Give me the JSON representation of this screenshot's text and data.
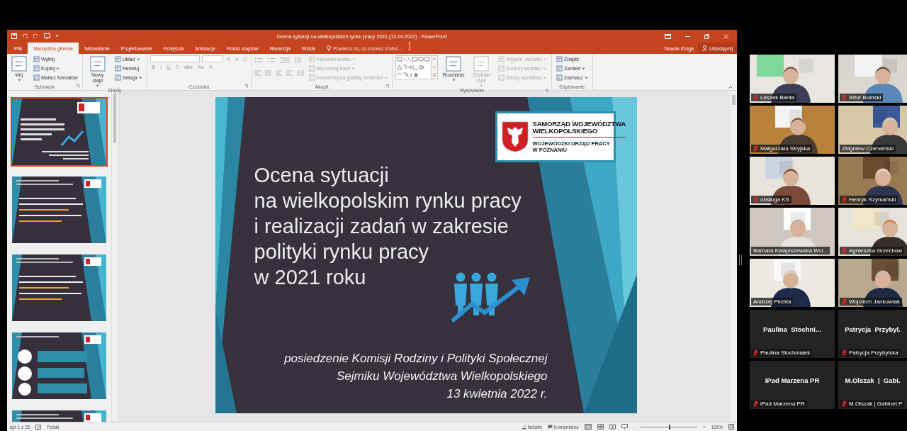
{
  "powerpoint": {
    "window": {
      "title": "Ocena sytuacji na wielkopolskim rynku pracy 2021 (13.04.2022) - PowerPoint"
    },
    "tabs": [
      {
        "label": "Plik",
        "selected": false
      },
      {
        "label": "Narzędzia główne",
        "selected": true
      },
      {
        "label": "Wstawianie",
        "selected": false
      },
      {
        "label": "Projektowanie",
        "selected": false
      },
      {
        "label": "Przejścia",
        "selected": false
      },
      {
        "label": "Animacje",
        "selected": false
      },
      {
        "label": "Pokaz slajdów",
        "selected": false
      },
      {
        "label": "Recenzja",
        "selected": false
      },
      {
        "label": "Widok",
        "selected": false
      }
    ],
    "tell_me": "Powiedz mi, co chcesz zrobić...",
    "user": "Nowak Kinga",
    "share_button": "Udostępnij",
    "ribbon": [
      {
        "label": "Schowek",
        "launcher": true,
        "columns": [
          [
            {
              "kind": "large",
              "label": "klej",
              "dropdown": true,
              "disabled": false
            }
          ],
          [
            {
              "kind": "small",
              "label": "Wytnij",
              "dropdown": false,
              "disabled": false
            },
            {
              "kind": "small",
              "label": "Kopiuj",
              "dropdown": true,
              "disabled": false
            },
            {
              "kind": "small",
              "label": "Malarz formatów",
              "dropdown": false,
              "disabled": false
            }
          ]
        ]
      },
      {
        "label": "Slajdy",
        "launcher": false,
        "columns": [
          [
            {
              "kind": "large",
              "label": "Nowy slajd",
              "dropdown": true,
              "disabled": false
            }
          ],
          [
            {
              "kind": "small",
              "label": "Układ",
              "dropdown": true,
              "disabled": false
            },
            {
              "kind": "small",
              "label": "Resetuj",
              "dropdown": false,
              "disabled": false
            },
            {
              "kind": "small",
              "label": "Sekcja",
              "dropdown": true,
              "disabled": false
            }
          ]
        ]
      },
      {
        "label": "Czcionka",
        "launcher": true,
        "columns": [
          [
            {
              "kind": "fields",
              "buttons": [
                "A",
                "A"
              ],
              "disabled": true
            },
            {
              "kind": "format",
              "buttons": [
                "B",
                "I",
                "U",
                "S",
                "abc",
                "Aa",
                "A"
              ],
              "disabled": true
            }
          ]
        ]
      },
      {
        "label": "Akapit",
        "launcher": true,
        "columns": [
          [
            {
              "kind": "paragraph_icons",
              "disabled": true
            }
          ],
          [
            {
              "kind": "small",
              "label": "Kierunek tekstu",
              "dropdown": true,
              "disabled": true
            },
            {
              "kind": "small",
              "label": "Wyrównaj tekst",
              "dropdown": true,
              "disabled": true
            },
            {
              "kind": "small",
              "label": "Konwertuj na grafikę SmartArt",
              "dropdown": true,
              "disabled": true
            }
          ]
        ]
      },
      {
        "label": "Rysowanie",
        "launcher": true,
        "columns": [
          [
            {
              "kind": "shapes",
              "disabled": false
            }
          ],
          [
            {
              "kind": "large",
              "label": "Rozmieść",
              "dropdown": true,
              "disabled": false
            }
          ],
          [
            {
              "kind": "large",
              "label": "Szybkie style",
              "dropdown": true,
              "disabled": true
            }
          ],
          [
            {
              "kind": "small",
              "label": "Wypełn. kształtu",
              "dropdown": true,
              "disabled": true
            },
            {
              "kind": "small",
              "label": "Kontury kształtu",
              "dropdown": true,
              "disabled": true
            },
            {
              "kind": "small",
              "label": "Efekty kształtów",
              "dropdown": true,
              "disabled": true
            }
          ]
        ]
      },
      {
        "label": "Edytowanie",
        "launcher": false,
        "columns": [
          [
            {
              "kind": "small",
              "label": "Znajdź",
              "dropdown": false,
              "disabled": false
            },
            {
              "kind": "small",
              "label": "Zamień",
              "dropdown": true,
              "disabled": false
            },
            {
              "kind": "small",
              "label": "Zaznacz",
              "dropdown": true,
              "disabled": false
            }
          ]
        ]
      }
    ],
    "thumbnails": [
      {
        "kind": "title",
        "selected": true
      },
      {
        "kind": "text",
        "selected": false
      },
      {
        "kind": "text",
        "selected": false
      },
      {
        "kind": "icons",
        "selected": false
      },
      {
        "kind": "text",
        "selected": false
      }
    ],
    "slide": {
      "logo": {
        "heading": [
          "SAMORZĄD WOJEWÓDZTWA",
          "WIELKOPOLSKIEGO"
        ],
        "subheading": [
          "WOJEWÓDZKI URZĄD PRACY",
          "W POZNANIU"
        ]
      },
      "title_lines": [
        "Ocena sytuacji",
        "na wielkopolskim rynku pracy",
        "i realizacji zadań w zakresie",
        "polityki rynku pracy",
        "w 2021 roku"
      ],
      "subtitle_lines": [
        "posiedzenie Komisji Rodziny i Polityki Społecznej",
        "Sejmiku Województwa Wielkopolskiego",
        "13 kwietnia 2022 r."
      ]
    },
    "status_bar": {
      "slide_counter": "ajd 1 z 25",
      "language": "Polski",
      "notes": "Notatki",
      "comments": "Komentarze",
      "zoom_out": "-",
      "zoom_in": "+",
      "zoom_slider": {
        "level": 0.5
      },
      "zoom": "115%"
    }
  },
  "participants": [
    {
      "kind": "video",
      "name": "Leszek Bierła",
      "muted": true,
      "speaking": false
    },
    {
      "kind": "video",
      "name": "Artur Boiński",
      "muted": true,
      "speaking": false
    },
    {
      "kind": "video",
      "name": "Małgorzata Stryjska",
      "muted": true,
      "speaking": false
    },
    {
      "kind": "video",
      "name": "Zbigniew Czerwiński",
      "muted": false,
      "speaking": false
    },
    {
      "kind": "video",
      "name": "obsługa KS",
      "muted": true,
      "speaking": false
    },
    {
      "kind": "video",
      "name": "Henryk Szymański",
      "muted": true,
      "speaking": false
    },
    {
      "kind": "video",
      "name": "Barbara Kwapiszewska WU...",
      "muted": false,
      "speaking": true
    },
    {
      "kind": "video",
      "name": "Agnieszka Grzechow",
      "muted": true,
      "speaking": false
    },
    {
      "kind": "video",
      "name": "Andrzej Plichta",
      "muted": false,
      "speaking": false
    },
    {
      "kind": "video",
      "name": "Wojciech Jankowiak",
      "muted": true,
      "speaking": false
    },
    {
      "kind": "name",
      "display_name": "Paulina  Stochni...",
      "name": "Paulina Stochniałek",
      "muted": true,
      "speaking": false
    },
    {
      "kind": "name",
      "display_name": "Patrycja  Przybyl.",
      "name": "Patrycja Przybylska",
      "muted": true,
      "speaking": false
    },
    {
      "kind": "name",
      "display_name": "iPad Marzena PR",
      "name": "iPad Marzena PR",
      "muted": true,
      "speaking": false
    },
    {
      "kind": "name",
      "display_name": "M.Olszak  |  Gabi.",
      "name": "M.Olszak | Gabinet P",
      "muted": true,
      "speaking": false
    }
  ]
}
